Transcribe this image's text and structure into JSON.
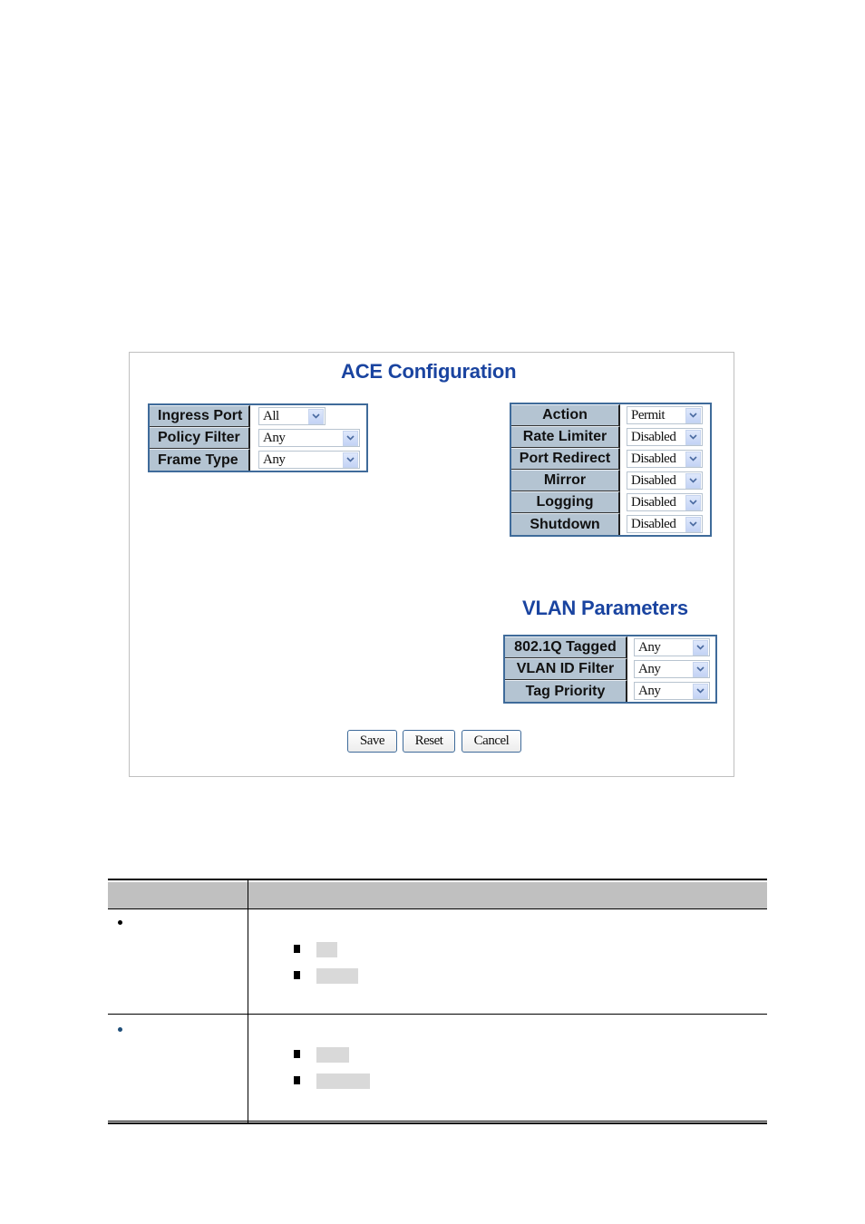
{
  "ace_config": {
    "title": "ACE Configuration",
    "left_fields": [
      {
        "label": "Ingress Port",
        "value": "All"
      },
      {
        "label": "Policy Filter",
        "value": "Any"
      },
      {
        "label": "Frame Type",
        "value": "Any"
      }
    ],
    "right_fields": [
      {
        "label": "Action",
        "value": "Permit"
      },
      {
        "label": "Rate Limiter",
        "value": "Disabled"
      },
      {
        "label": "Port Redirect",
        "value": "Disabled"
      },
      {
        "label": "Mirror",
        "value": "Disabled"
      },
      {
        "label": "Logging",
        "value": "Disabled"
      },
      {
        "label": "Shutdown",
        "value": "Disabled"
      }
    ]
  },
  "vlan_params": {
    "title": "VLAN Parameters",
    "fields": [
      {
        "label": "802.1Q Tagged",
        "value": "Any"
      },
      {
        "label": "VLAN ID Filter",
        "value": "Any"
      },
      {
        "label": "Tag Priority",
        "value": "Any"
      }
    ]
  },
  "buttons": {
    "save": "Save",
    "reset": "Reset",
    "cancel": "Cancel"
  },
  "icons": {
    "dropdown_arrow": "chevron-down-icon",
    "list_bullet": "square-bullet-icon"
  },
  "colors": {
    "heading": "#1a44a0",
    "label_bg": "#b4c4d2",
    "table_border": "#3f6b9a",
    "doc_header_bg": "#c0c0c0",
    "redacted_bg": "#d9d9d9"
  }
}
